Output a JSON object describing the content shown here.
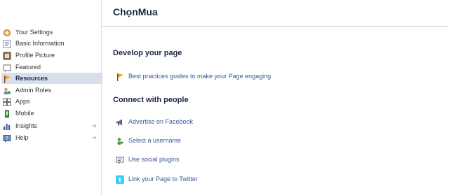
{
  "page": {
    "title": "ChọnMua"
  },
  "sidebar": {
    "items": [
      {
        "label": "Your Settings",
        "icon": "settings-icon"
      },
      {
        "label": "Basic Information",
        "icon": "info-icon"
      },
      {
        "label": "Profile Picture",
        "icon": "picture-icon"
      },
      {
        "label": "Featured",
        "icon": "featured-icon"
      },
      {
        "label": "Resources",
        "icon": "resources-icon",
        "selected": true
      },
      {
        "label": "Admin Roles",
        "icon": "admin-roles-icon"
      },
      {
        "label": "Apps",
        "icon": "apps-icon"
      },
      {
        "label": "Mobile",
        "icon": "mobile-icon"
      },
      {
        "label": "Insights",
        "icon": "insights-icon",
        "arrow": "➔"
      },
      {
        "label": "Help",
        "icon": "help-icon",
        "arrow": "➔"
      }
    ]
  },
  "develop": {
    "heading": "Develop your page",
    "links": [
      {
        "label": "Best practices guides to make your Page engaging",
        "icon": "flag-icon"
      }
    ]
  },
  "connect": {
    "heading": "Connect with people",
    "links": [
      {
        "label": "Advertise on Facebook",
        "icon": "megaphone-icon"
      },
      {
        "label": "Select a username",
        "icon": "username-icon"
      },
      {
        "label": "Use social plugins",
        "icon": "plugin-icon"
      },
      {
        "label": "Link your Page to Twitter",
        "icon": "twitter-icon"
      }
    ]
  },
  "colors": {
    "link": "#3b5998",
    "selected_bg": "#d8dfea",
    "heading": "#1c2a47",
    "twitter": "#33ccff"
  }
}
